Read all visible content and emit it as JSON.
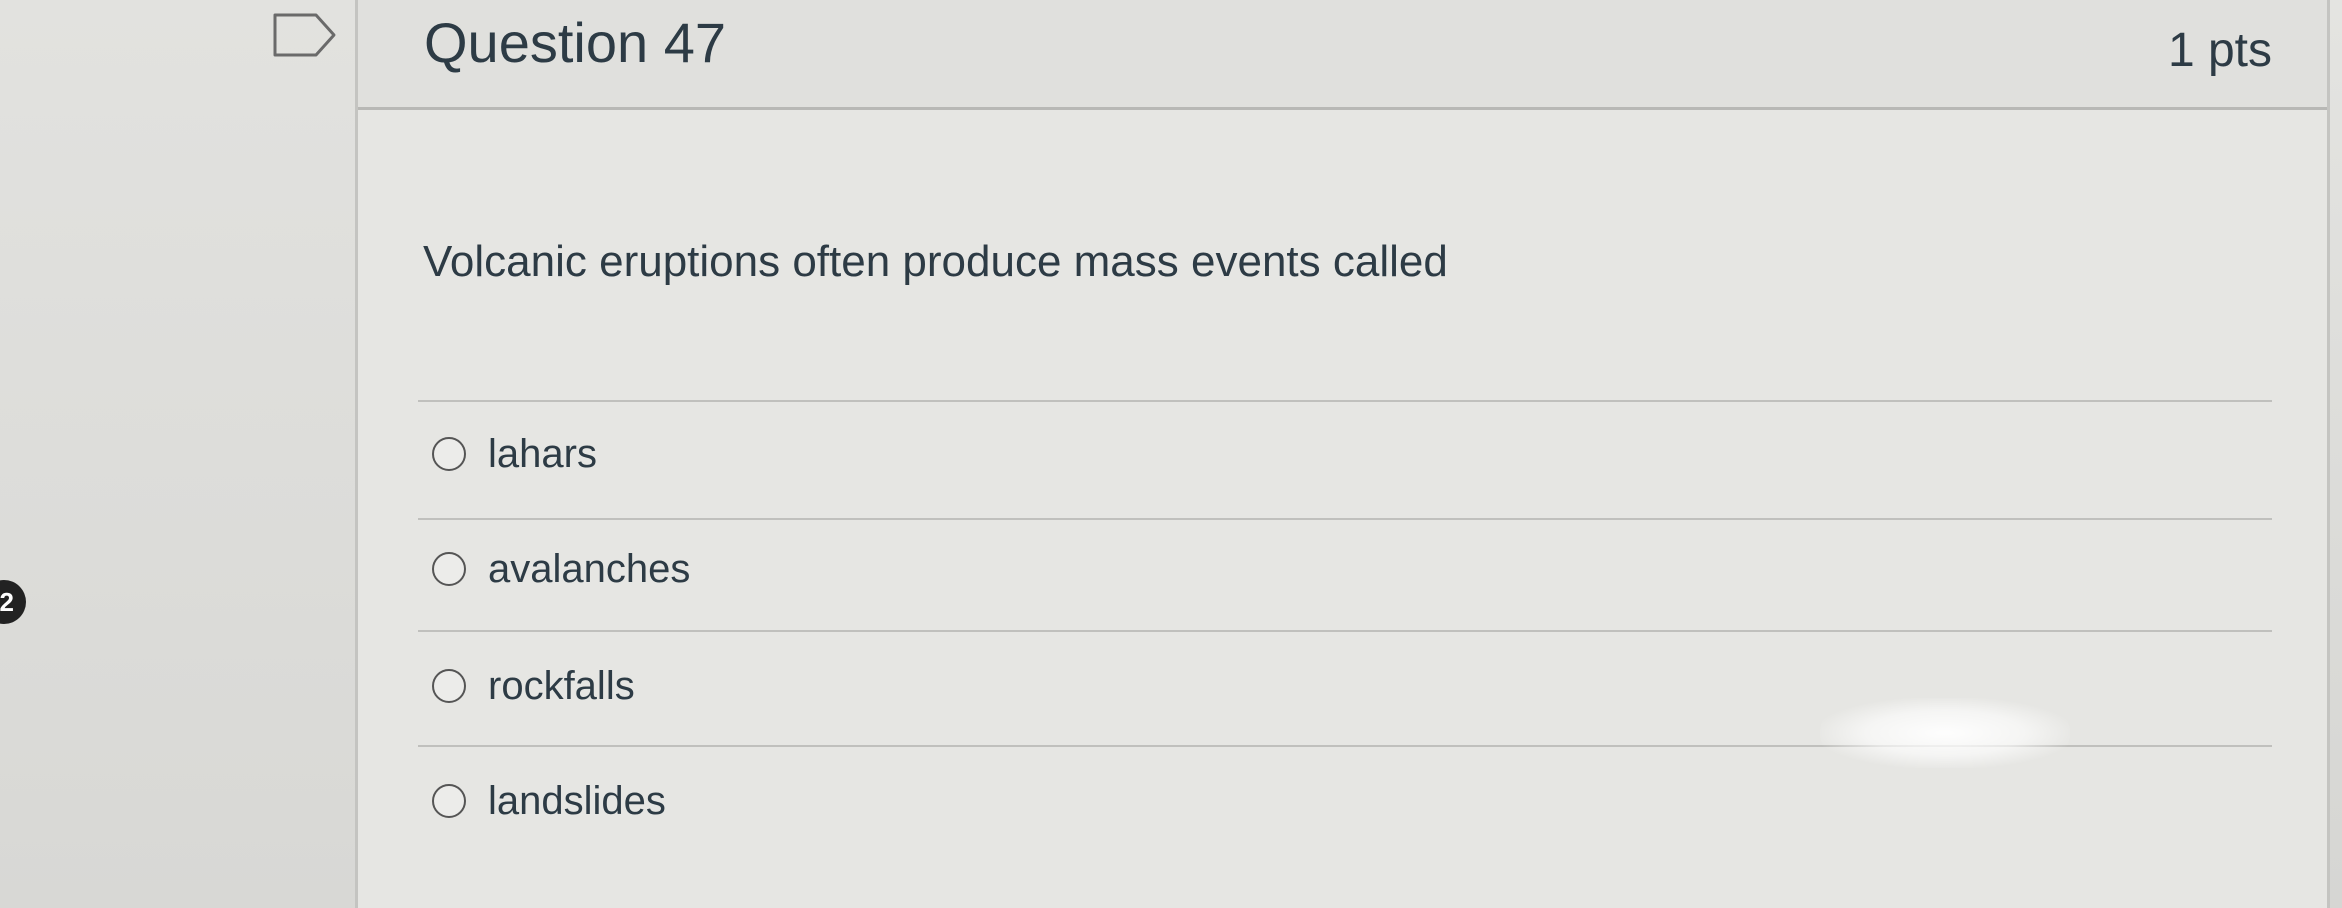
{
  "badge": "2",
  "question": {
    "title": "Question 47",
    "points": "1 pts",
    "text": "Volcanic eruptions often produce mass events called",
    "answers": [
      {
        "label": "lahars"
      },
      {
        "label": "avalanches"
      },
      {
        "label": "rockfalls"
      },
      {
        "label": "landslides"
      }
    ]
  },
  "icons": {
    "flag": "flag-bookmark-icon",
    "radio": "radio-unselected-icon"
  },
  "colors": {
    "text": "#2d3b45",
    "badge": "#222222"
  }
}
